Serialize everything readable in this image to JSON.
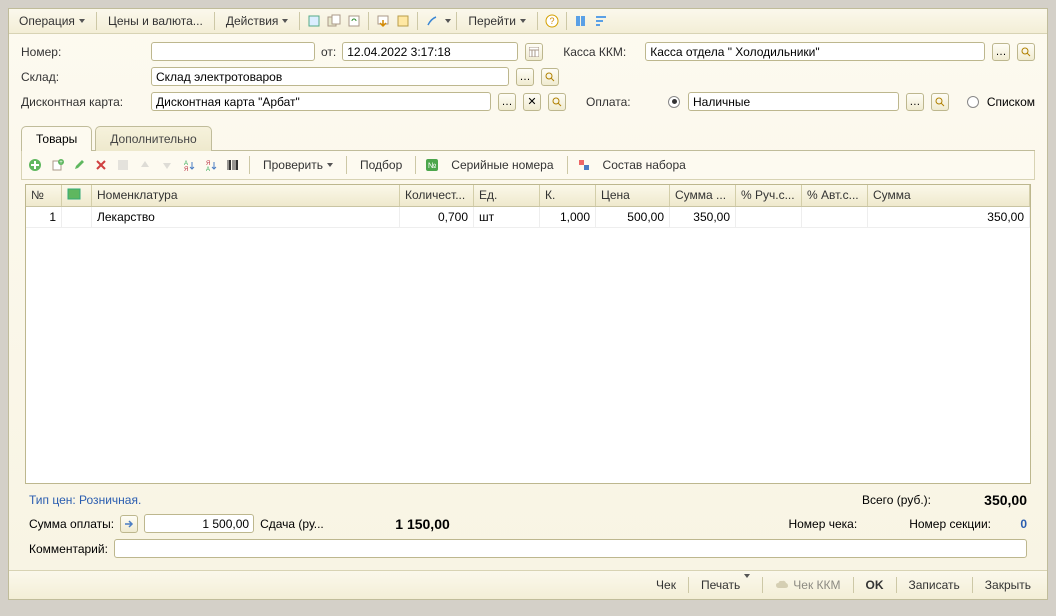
{
  "topmenu": {
    "operation": "Операция",
    "prices": "Цены и валюта...",
    "actions": "Действия",
    "go": "Перейти"
  },
  "labels": {
    "number": "Номер:",
    "from": "от:",
    "kkm": "Касса ККМ:",
    "warehouse": "Склад:",
    "discount_card": "Дисконтная карта:",
    "payment": "Оплата:",
    "list": "Списком",
    "price_type": "Тип цен: Розничная.",
    "total_rub": "Всего (руб.):",
    "payment_sum": "Сумма оплаты:",
    "change": "Сдача (ру...",
    "check_number": "Номер чека:",
    "section_number": "Номер секции:",
    "comment": "Комментарий:"
  },
  "values": {
    "number": "",
    "date": "12.04.2022  3:17:18",
    "kkm": "Касса отдела \" Холодильники\"",
    "warehouse": "Склад электротоваров",
    "discount_card": "Дисконтная карта \"Арбат\"",
    "payment": "Наличные",
    "total": "350,00",
    "payment_sum": "1 500,00",
    "change": "1 150,00",
    "section_number": "0",
    "comment": ""
  },
  "tabs": {
    "goods": "Товары",
    "more": "Дополнительно"
  },
  "grid_toolbar": {
    "check": "Проверить",
    "selection": "Подбор",
    "serials": "Серийные номера",
    "bundle": "Состав набора"
  },
  "grid": {
    "columns": {
      "n": "№",
      "extra": "",
      "nomenclature": "Номенклатура",
      "qty": "Количест...",
      "unit": "Ед.",
      "k": "К.",
      "price": "Цена",
      "sum_partial": "Сумма ...",
      "manual_pct": "% Руч.с...",
      "auto_pct": "% Авт.с...",
      "sum": "Сумма"
    },
    "rows": [
      {
        "n": "1",
        "nomenclature": "Лекарство",
        "qty": "0,700",
        "unit": "шт",
        "k": "1,000",
        "price": "500,00",
        "sum_partial": "350,00",
        "manual_pct": "",
        "auto_pct": "",
        "sum": "350,00"
      }
    ]
  },
  "bottom": {
    "check": "Чек",
    "print": "Печать",
    "check_kkm": "Чек ККМ",
    "ok": "OK",
    "save": "Записать",
    "close": "Закрыть"
  }
}
